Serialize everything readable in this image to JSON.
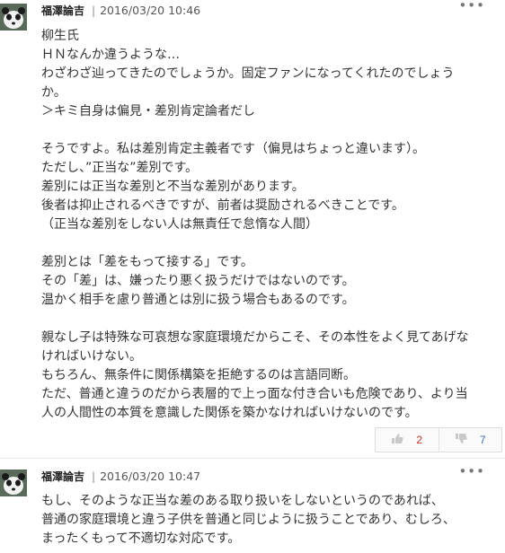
{
  "comments": [
    {
      "author": "福澤論吉",
      "separator": "|",
      "timestamp": "2016/03/20 10:46",
      "more": "•••",
      "lines": [
        "柳生氏",
        "ＨＮなんか違うような…",
        "わざわざ辿ってきたのでしょうか。固定ファンになってくれたのでしょう",
        "か。",
        "＞キミ自身は偏見・差別肯定論者だし",
        "",
        "そうですよ。私は差別肯定主義者です（偏見はちょっと違います）。",
        "ただし、”正当な”差別です。",
        "差別には正当な差別と不当な差別があります。",
        "後者は抑止されるべきですが、前者は奨励されるべきことです。",
        "（正当な差別をしない人は無責任で怠惰な人間）",
        "",
        "差別とは「差をもって接する」です。",
        "その「差」は、嫌ったり悪く扱うだけではないのです。",
        "温かく相手を慮り普通とは別に扱う場合もあるのです。",
        "",
        "親なし子は特殊な可哀想な家庭環境だからこそ、その本性をよく見てあげな",
        "ければいけない。",
        "もちろん、無条件に関係構築を拒絶するのは言語同断。",
        "ただ、普通と違うのだから表層的で上っ面な付き合いも危険であり、より当",
        "人の人間性の本質を意識した関係を築かなければいけないのです。"
      ],
      "votes": {
        "up": "2",
        "down": "7"
      }
    },
    {
      "author": "福澤論吉",
      "separator": "|",
      "timestamp": "2016/03/20 10:47",
      "more": "•••",
      "lines": [
        "もし、そのような正当な差のある取り扱いをしないというのであれば、",
        "普通の家庭環境と違う子供を普通と同じように扱うことであり、むしろ、",
        "まったくもって不適切な対応です。"
      ]
    }
  ],
  "icons": {
    "thumbs_up": "thumbs-up-icon",
    "thumbs_down": "thumbs-down-icon",
    "more": "more-icon"
  },
  "colors": {
    "up_count": "#c0392b",
    "down_count": "#3b6cb5"
  }
}
